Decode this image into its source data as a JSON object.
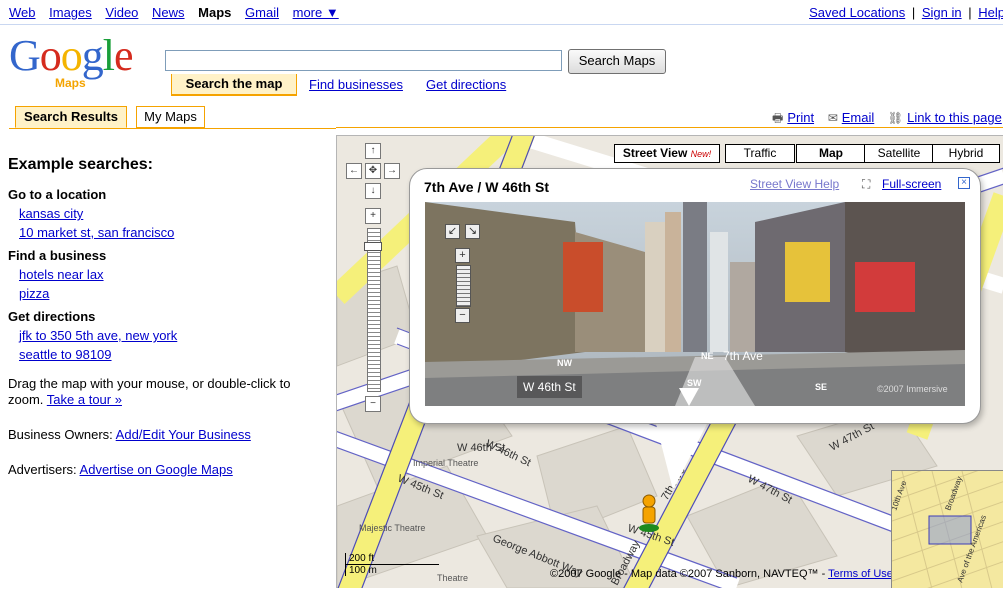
{
  "topnav": {
    "items": [
      "Web",
      "Images",
      "Video",
      "News",
      "Maps",
      "Gmail",
      "more ▼"
    ],
    "current": "Maps",
    "right_links": [
      "Saved Locations",
      "Sign in",
      "Help"
    ],
    "separator": "|"
  },
  "logo": {
    "word": "Google",
    "sub": "Maps"
  },
  "search": {
    "value": "",
    "button": "Search Maps"
  },
  "search_tabs": {
    "active": "Search the map",
    "find": "Find businesses",
    "directions": "Get directions"
  },
  "result_tabs": {
    "results": "Search Results",
    "mymaps": "My Maps"
  },
  "actions": {
    "print": "Print",
    "email": "Email",
    "link": "Link to this page"
  },
  "sidebar": {
    "heading": "Example searches:",
    "groups": [
      {
        "title": "Go to a location",
        "examples": [
          "kansas city",
          "10 market st, san francisco"
        ]
      },
      {
        "title": "Find a business",
        "examples": [
          "hotels near lax",
          "pizza"
        ]
      },
      {
        "title": "Get directions",
        "examples": [
          "jfk to 350 5th ave, new york",
          "seattle to 98109"
        ]
      }
    ],
    "drag_text": "Drag the map with your mouse, or double-click to zoom.",
    "tour_link": "Take a tour »",
    "owners_text": "Business Owners:",
    "owners_link": "Add/Edit Your Business",
    "advertisers_text": "Advertisers:",
    "advertisers_link": "Advertise on Google Maps"
  },
  "map": {
    "types": {
      "streetview": "Street View",
      "new": "New!",
      "traffic": "Traffic",
      "map": "Map",
      "satellite": "Satellite",
      "hybrid": "Hybrid"
    },
    "selected_type": "Map",
    "street_labels": [
      "W 46th St",
      "W 46th St",
      "W 45th St",
      "W 47th St",
      "W 47th St",
      "7th Ave",
      "Broadway",
      "George Abbott Way",
      "W 45th St"
    ],
    "theatre_labels": [
      "Imperial Theatre",
      "Majestic Theatre",
      "Theatre"
    ],
    "scale": {
      "ft": "200 ft",
      "m": "100 m"
    },
    "copyright": "©2007 Google - Map data ©2007 Sanborn, NAVTEQ™ -",
    "terms": "Terms of Use",
    "overview_labels": [
      "10th Ave",
      "Broadway",
      "Ave of the Americas"
    ]
  },
  "bubble": {
    "title": "7th Ave / W 46th St",
    "help": "Street View Help",
    "fullscreen": "Full-screen",
    "photo_labels": {
      "street1": "W 46th St",
      "street2": "7th Ave",
      "dir_ne": "NE",
      "dir_nw": "NW",
      "dir_sw": "SW",
      "dir_se": "SE",
      "credit": "©2007 Immersive"
    }
  },
  "colors": {
    "link": "#0000cc",
    "tab_accent": "#f5a300",
    "road_yellow": "#f5f07a",
    "road_blue": "#3d3db8",
    "map_bg": "#ece8e0"
  }
}
